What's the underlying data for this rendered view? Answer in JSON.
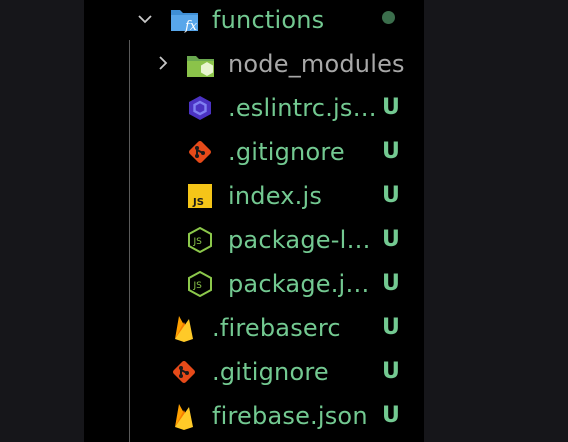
{
  "explorer": {
    "items": [
      {
        "name": "functions",
        "icon": "folder-functions-icon",
        "expanded": true,
        "status": "dot"
      },
      {
        "name": "node_modules",
        "icon": "folder-node-icon",
        "expanded": false,
        "status": ""
      },
      {
        "name": ".eslintrc.js…",
        "icon": "eslint-icon",
        "status": "U"
      },
      {
        "name": ".gitignore",
        "icon": "git-icon",
        "status": "U"
      },
      {
        "name": "index.js",
        "icon": "javascript-icon",
        "status": "U"
      },
      {
        "name": "package-l…",
        "icon": "nodejs-icon",
        "status": "U"
      },
      {
        "name": "package.j…",
        "icon": "nodejs-icon",
        "status": "U"
      },
      {
        "name": ".firebaserc",
        "icon": "firebase-icon",
        "status": "U"
      },
      {
        "name": ".gitignore",
        "icon": "git-icon",
        "status": "U"
      },
      {
        "name": "firebase.json",
        "icon": "firebase-icon",
        "status": "U"
      }
    ]
  },
  "colors": {
    "untracked": "#73c991",
    "muted": "#a8a8a8",
    "background": "#000000"
  }
}
